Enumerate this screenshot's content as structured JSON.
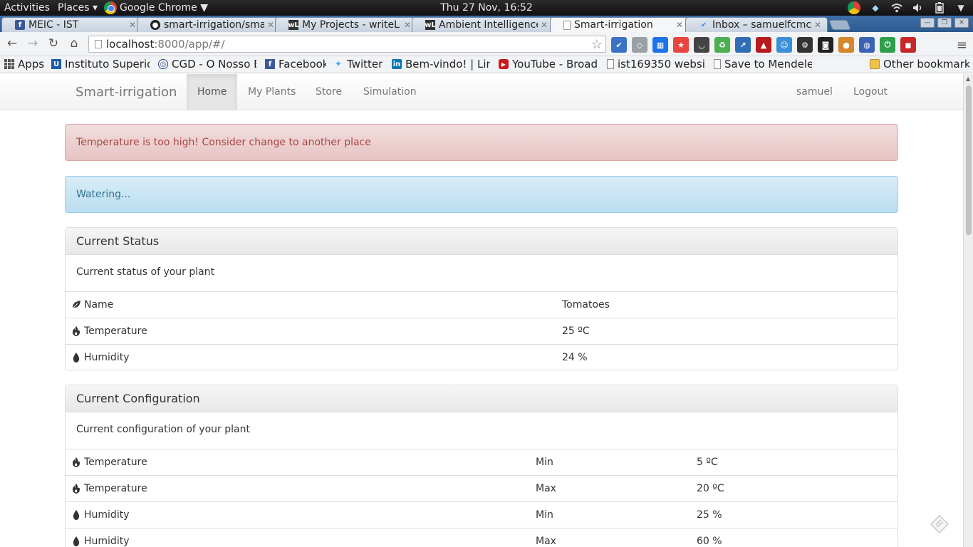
{
  "system_bar": {
    "activities": "Activities",
    "places": "Places ▾",
    "app": "Google Chrome",
    "clock": "Thu 27 Nov, 16:52"
  },
  "tabs": [
    {
      "label": "MEIC - IST",
      "favicon": "facebook-icon"
    },
    {
      "label": "smart-irrigation/sma",
      "favicon": "github-icon"
    },
    {
      "label": "My Projects - writeL",
      "favicon": "writelatex-icon"
    },
    {
      "label": "Ambient Intelligence",
      "favicon": "writelatex-icon"
    },
    {
      "label": "Smart-irrigation",
      "favicon": "page-icon",
      "active": true
    },
    {
      "label": "Inbox – samuelfcmc@",
      "favicon": "inbox-icon"
    }
  ],
  "omnibox": {
    "host": "localhost",
    "path": ":8000/app/#/"
  },
  "bookmarks": [
    {
      "label": "Apps",
      "icon": "apps-grid-icon"
    },
    {
      "label": "Instituto Superior",
      "icon": "ist-icon"
    },
    {
      "label": "CGD - O Nosso B",
      "icon": "cgd-icon"
    },
    {
      "label": "Facebook",
      "icon": "facebook-icon"
    },
    {
      "label": "Twitter",
      "icon": "twitter-icon"
    },
    {
      "label": "Bem-vindo! | Link",
      "icon": "linkedin-icon"
    },
    {
      "label": "YouTube - Broadc",
      "icon": "youtube-icon"
    },
    {
      "label": "ist169350 websi",
      "icon": "page-icon"
    },
    {
      "label": "Save to Mendeley",
      "icon": "page-icon"
    },
    {
      "label": "Other bookmarks",
      "icon": "folder-icon"
    }
  ],
  "navbar": {
    "brand": "Smart-irrigation",
    "links": [
      "Home",
      "My Plants",
      "Store",
      "Simulation"
    ],
    "user": "samuel",
    "logout": "Logout"
  },
  "alerts": {
    "danger": "Temperature is too high! Consider change to another place",
    "info": "Watering..."
  },
  "status_panel": {
    "title": "Current Status",
    "subtitle": "Current status of your plant",
    "rows": [
      {
        "icon": "leaf-icon",
        "label": "Name",
        "value": "Tomatoes"
      },
      {
        "icon": "fire-icon",
        "label": "Temperature",
        "value": "25 ºC"
      },
      {
        "icon": "drop-icon",
        "label": "Humidity",
        "value": "24 %"
      }
    ]
  },
  "config_panel": {
    "title": "Current Configuration",
    "subtitle": "Current configuration of your plant",
    "rows": [
      {
        "icon": "fire-icon",
        "label": "Temperature",
        "bound": "Min",
        "value": "5 ºC"
      },
      {
        "icon": "fire-icon",
        "label": "Temperature",
        "bound": "Max",
        "value": "20 ºC"
      },
      {
        "icon": "drop-icon",
        "label": "Humidity",
        "bound": "Min",
        "value": "25 %"
      },
      {
        "icon": "drop-icon",
        "label": "Humidity",
        "bound": "Max",
        "value": "60 %"
      }
    ]
  }
}
